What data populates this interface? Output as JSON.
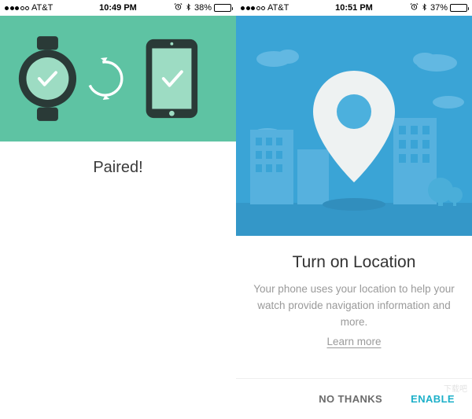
{
  "left": {
    "status": {
      "carrier": "AT&T",
      "time": "10:49 PM",
      "battery_pct": "38%"
    },
    "title": "Paired!"
  },
  "right": {
    "status": {
      "carrier": "AT&T",
      "time": "10:51 PM",
      "battery_pct": "37%"
    },
    "title": "Turn on Location",
    "description": "Your phone uses your location to help your watch provide navigation information and more.",
    "learn_more": "Learn more",
    "no_thanks": "NO THANKS",
    "enable": "ENABLE"
  },
  "watermark": "下载吧"
}
